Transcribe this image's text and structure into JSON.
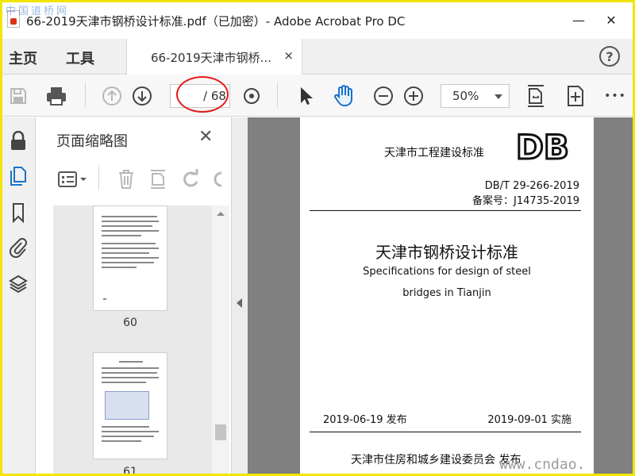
{
  "window": {
    "title": "66-2019天津市钢桥设计标准.pdf（已加密）- Adobe Acrobat Pro DC",
    "watermark_top": "中国道桥网",
    "minimize": "—",
    "close": "✕"
  },
  "tabbar": {
    "menu_home": "主页",
    "menu_tools": "工具",
    "doc_tab_label": "66-2019天津市钢桥...",
    "doc_tab_close": "×",
    "help": "?"
  },
  "toolbar": {
    "page_current": "",
    "page_total": "/ 68",
    "zoom": "50%",
    "more": "•••"
  },
  "panel": {
    "title": "页面缩略图",
    "close": "✕",
    "thumbnails": [
      {
        "label": "60"
      },
      {
        "label": "61"
      }
    ]
  },
  "document": {
    "header": "天津市工程建设标准",
    "logo_text": "DB",
    "std_number": "DB/T  29-266-2019",
    "record_number": "备案号：J14735-2019",
    "title_cn": "天津市钢桥设计标准",
    "title_en_1": "Specifications for design of steel",
    "title_en_2": "bridges in Tianjin",
    "issue_date": "2019-06-19  发布",
    "impl_date": "2019-09-01  实施",
    "issuer": "天津市住房和城乡建设委员会    发布"
  },
  "watermark_bottom": "www.cndao.",
  "colors": {
    "accent": "#1a73c8",
    "annotation": "#e31a1a",
    "frame": "#f0e600"
  }
}
